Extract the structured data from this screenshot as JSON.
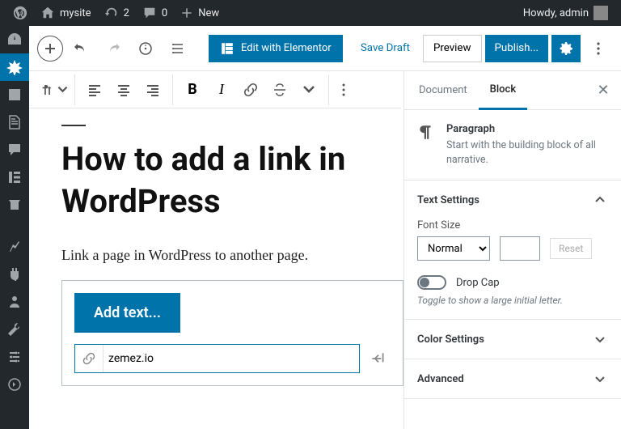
{
  "adminbar": {
    "site_name": "mysite",
    "update_count": "2",
    "comment_count": "0",
    "new_label": "New",
    "howdy": "Howdy, admin"
  },
  "topbar": {
    "elementor_label": "Edit with Elementor",
    "save_draft": "Save Draft",
    "preview": "Preview",
    "publish": "Publish..."
  },
  "editor": {
    "title": "How to add a link in WordPress",
    "paragraph": "Link a page in WordPress to another page.",
    "add_text_label": "Add text...",
    "link_url": "zemez.io"
  },
  "inspector": {
    "tabs": {
      "document": "Document",
      "block": "Block"
    },
    "block_info": {
      "title": "Paragraph",
      "desc": "Start with the building block of all narrative."
    },
    "text_settings": {
      "heading": "Text Settings",
      "font_size_label": "Font Size",
      "font_size_value": "Normal",
      "reset": "Reset",
      "drop_cap": "Drop Cap",
      "drop_cap_help": "Toggle to show a large initial letter."
    },
    "color_settings_heading": "Color Settings",
    "advanced_heading": "Advanced"
  }
}
